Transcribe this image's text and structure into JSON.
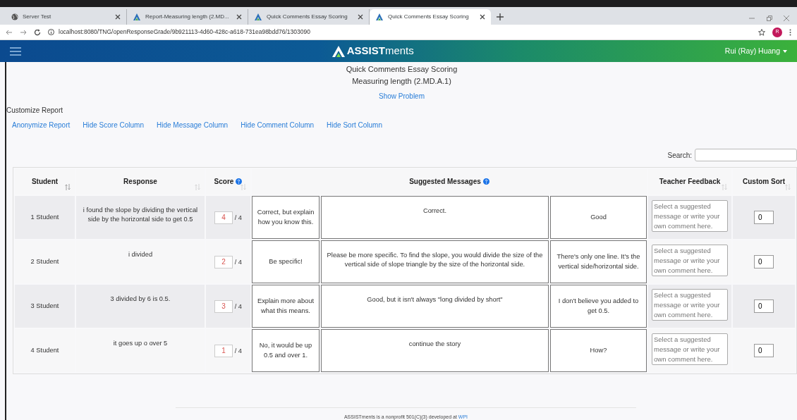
{
  "browser": {
    "tabs": [
      {
        "title": "Server Test",
        "kind": "globe",
        "selected": false
      },
      {
        "title": "Report-Measuring length (2.MD...",
        "kind": "logo",
        "selected": false
      },
      {
        "title": "Quick Comments Essay Scoring",
        "kind": "logo",
        "selected": false
      },
      {
        "title": "Quick Comments Essay Scoring",
        "kind": "logo",
        "selected": true
      }
    ],
    "address": "localhost:8080/TNG/openResponseGrade/9b921113-4d60-428c-a618-731ea98bdd76/1303090",
    "profile": "R"
  },
  "navbar": {
    "brand": "**ASSIST**ments",
    "user": "Rui (Ray) Huang"
  },
  "header": {
    "title": "Quick Comments Essay Scoring",
    "subtitle": "Measuring length (2.MD.A.1)",
    "link": "Show Problem"
  },
  "customize": {
    "label": "Customize Report",
    "links": [
      "Anonymize Report",
      "Hide Score Column",
      "Hide Message Column",
      "Hide Comment Column",
      "Hide Sort Column"
    ]
  },
  "search": {
    "label": "Search:"
  },
  "table": {
    "columns": [
      {
        "label": "Student",
        "sortable": true,
        "help": false
      },
      {
        "label": "Response",
        "sortable": true,
        "help": false
      },
      {
        "label": "Score",
        "sortable": true,
        "help": true
      },
      {
        "label": "Suggested Messages",
        "sortable": false,
        "help": true
      },
      {
        "label": "Teacher Feedback",
        "sortable": true,
        "help": false
      },
      {
        "label": "Custom Sort",
        "sortable": true,
        "help": false
      }
    ],
    "rows": [
      {
        "student": "1 Student",
        "response": "i found the slope by dividing the vertical side by the horizontal side to get 0.5",
        "score": "4",
        "max": "/ 4",
        "messages": [
          "Correct, but explain how you know this.",
          "Correct.",
          "Good"
        ],
        "feedback_placeholder": "Select a suggested message or write your own comment here.",
        "sort": "0"
      },
      {
        "student": "2 Student",
        "response": "i divided",
        "score": "2",
        "max": "/ 4",
        "messages": [
          "Be specific!",
          "Please be more specific. To find the slope, you would divide the size of the vertical side of slope triangle by the size of the horizontal side.",
          "There's only one line. It's the vertical side/horizontal side."
        ],
        "feedback_placeholder": "Select a suggested message or write your own comment here.",
        "sort": "0"
      },
      {
        "student": "3 Student",
        "response": "3 divided by 6 is 0.5.",
        "score": "3",
        "max": "/ 4",
        "messages": [
          "Explain more about what this means.",
          "Good, but it isn't always \"long divided by short\"",
          "I don't believe you added to get 0.5."
        ],
        "feedback_placeholder": "Select a suggested message or write your own comment here.",
        "sort": "0"
      },
      {
        "student": "4 Student",
        "response": "it goes up o over 5",
        "score": "1",
        "max": "/ 4",
        "messages": [
          "No, it would be up 0.5 and over 1.",
          "continue the story",
          "How?"
        ],
        "feedback_placeholder": "Select a suggested message or write your own comment here.",
        "sort": "0"
      }
    ]
  },
  "footer": {
    "text": "ASSISTments is a nonprofit 501(C)(3) developed at ",
    "link": "WPI"
  }
}
